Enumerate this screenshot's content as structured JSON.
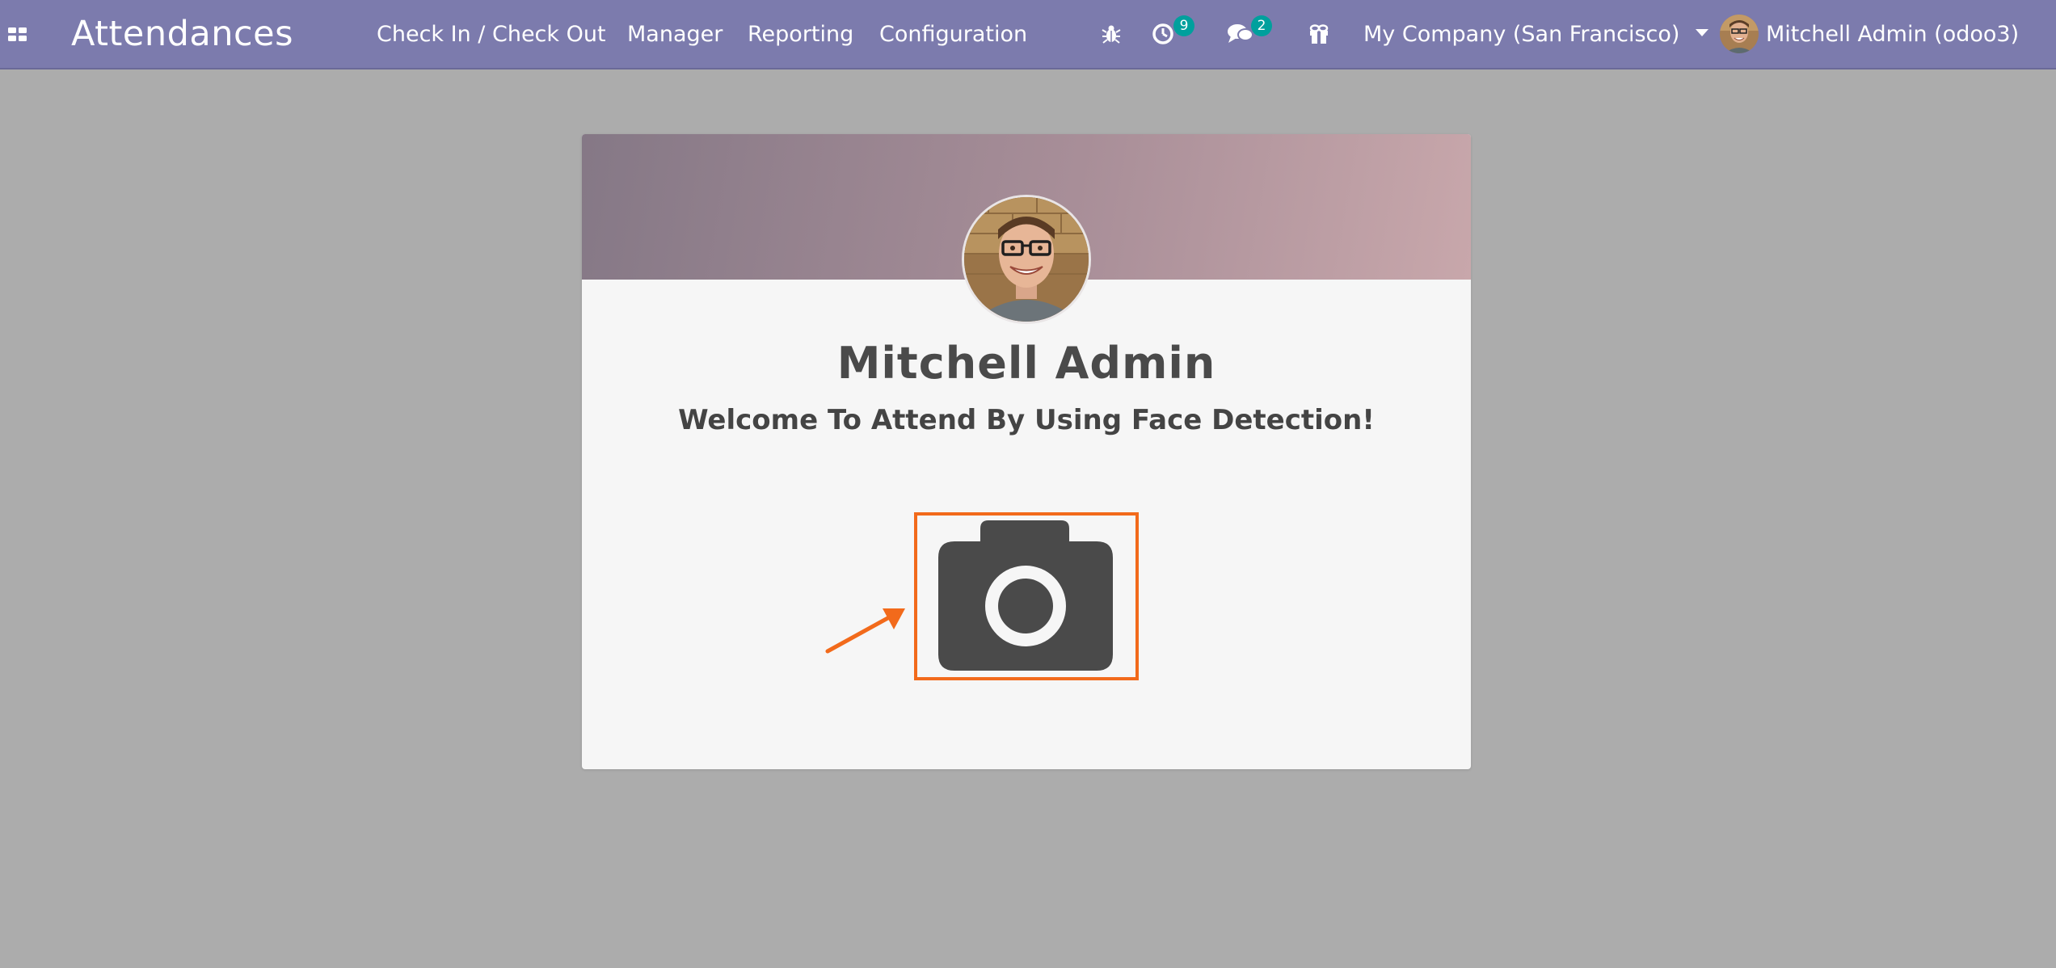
{
  "navbar": {
    "apps_icon": "grid-icon",
    "app_title": "Attendances",
    "menu": [
      {
        "label": "Check In / Check Out"
      },
      {
        "label": "Manager"
      },
      {
        "label": "Reporting"
      },
      {
        "label": "Configuration"
      }
    ],
    "systray": {
      "debug_icon": "bug-icon",
      "activity_icon": "clock-icon",
      "activity_count": "9",
      "messages_icon": "chat-icon",
      "messages_count": "2",
      "gift_icon": "gift-icon",
      "company": "My Company (San Francisco)",
      "user": "Mitchell Admin (odoo3)"
    }
  },
  "card": {
    "employee_name": "Mitchell Admin",
    "welcome": "Welcome To Attend By Using Face Detection!",
    "camera_icon": "camera-icon"
  },
  "colors": {
    "navbar": "#7c7bad",
    "background": "#acacac",
    "badge": "#00a09d",
    "highlight": "#f26a1b",
    "camera": "#4a4a4a"
  }
}
